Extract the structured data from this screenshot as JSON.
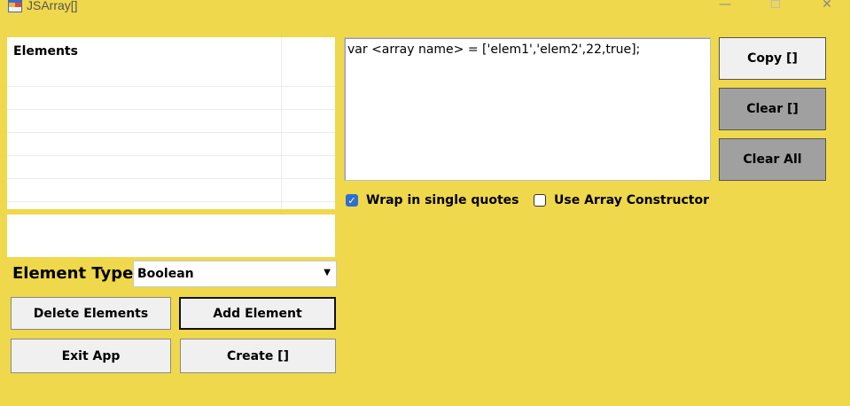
{
  "window": {
    "title": "JSArray[]",
    "minimize_glyph": "—",
    "close_glyph": "✕"
  },
  "list": {
    "header": "Elements",
    "items": []
  },
  "element_input": {
    "value": ""
  },
  "element_type": {
    "label": "Element Type",
    "selected": "Boolean"
  },
  "buttons": {
    "delete": "Delete Elements",
    "add": "Add Element",
    "exit": "Exit App",
    "create": "Create []",
    "copy": "Copy []",
    "clear": "Clear []",
    "clear_all": "Clear All"
  },
  "output": {
    "text": "var <array name> = ['elem1','elem2',22,true];"
  },
  "options": {
    "wrap_single_quotes": {
      "label": "Wrap in single quotes",
      "checked": true
    },
    "use_array_constructor": {
      "label": "Use Array Constructor",
      "checked": false
    }
  },
  "colors": {
    "background": "#efd84b",
    "checkbox_accent": "#2f6fcf",
    "disabled_button": "#a0a0a0"
  },
  "icons": {
    "app": "app-window-icon",
    "dropdown": "chevron-down-icon"
  }
}
